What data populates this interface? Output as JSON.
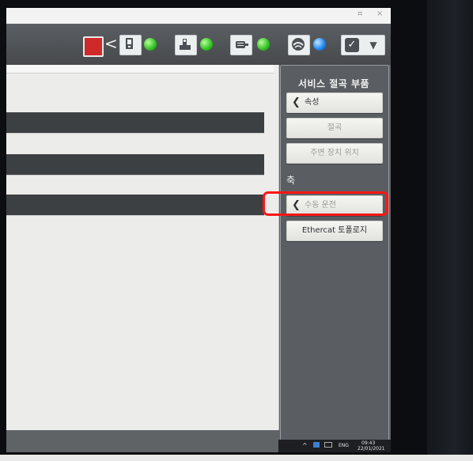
{
  "window": {
    "minimize_glyph": "¤",
    "close_glyph": "×"
  },
  "toolbar": {
    "back_glyph": "<",
    "icons": [
      "robot-cell-icon",
      "teach-pendant-icon",
      "usb-device-icon",
      "drive-motor-icon",
      "network-globe-icon",
      "checkbox-icon"
    ],
    "status_leds": [
      "green",
      "green",
      "green",
      "blue"
    ],
    "colors": {
      "led_green": "#30c021",
      "led_blue": "#1e84f0",
      "alert_red": "#cf2a2a"
    }
  },
  "panel": {
    "title": "서비스  절곡 부품",
    "items": [
      {
        "label": "속성",
        "has_back_chevron": true,
        "enabled": true
      },
      {
        "label": "절곡",
        "has_back_chevron": false,
        "enabled": false
      },
      {
        "label": "주변 장치 위치",
        "has_back_chevron": false,
        "enabled": false
      }
    ],
    "axis_section": "축",
    "axis_items": [
      {
        "label": "수동 운전",
        "has_back_chevron": true,
        "enabled": false,
        "highlighted": true
      },
      {
        "label": "Ethercat 토폴로지",
        "has_back_chevron": false,
        "enabled": true
      }
    ],
    "highlight_color": "#ff1616"
  },
  "taskbar": {
    "tray_glyph": "^",
    "language": "ENG",
    "time": "09:43",
    "date": "22/01/2021"
  }
}
